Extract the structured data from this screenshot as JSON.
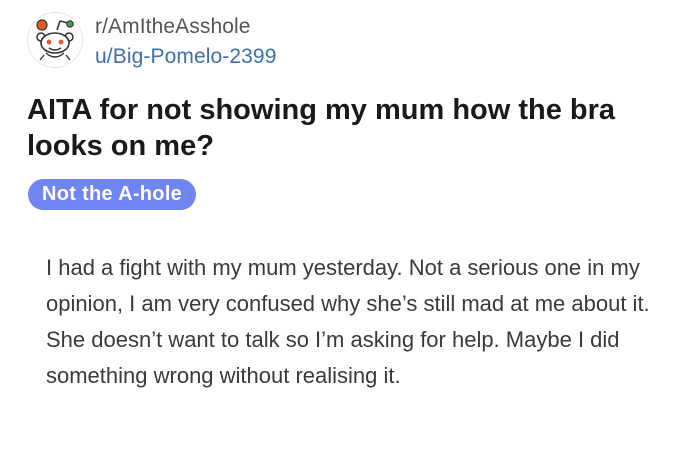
{
  "post": {
    "subreddit": "r/AmItheAsshole",
    "username": "u/Big-Pomelo-2399",
    "avatar_icon": "reddit-snoo-icon",
    "title": "AITA for not showing my mum how the bra looks on me?",
    "flair": {
      "label": "Not the A-hole",
      "color": "#6f85f3"
    },
    "body": "I had a fight with my mum yesterday. Not a serious one in my opinion, I am very confused why she’s still mad at me about it. She doesn’t want to talk so I’m asking for help. Maybe I did something wrong without realising it."
  }
}
